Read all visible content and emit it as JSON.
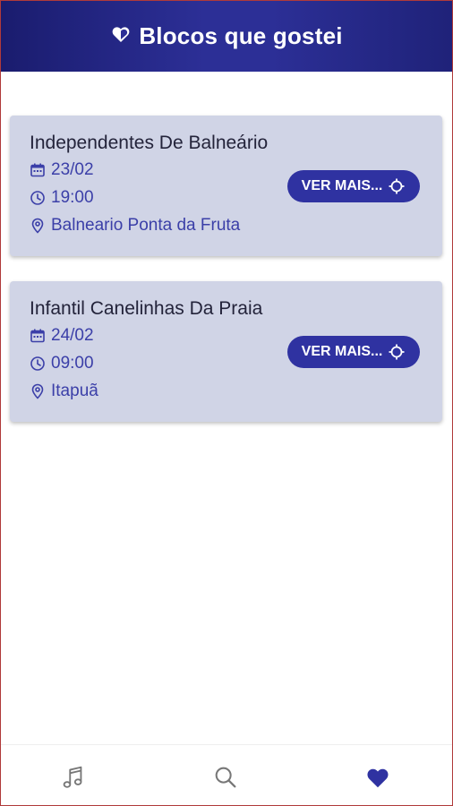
{
  "header": {
    "title": "Blocos que gostei",
    "icon": "heart-icon"
  },
  "cards": [
    {
      "name": "Independentes De Balneário",
      "date": "23/02",
      "time": "19:00",
      "place": "Balneario Ponta da Fruta",
      "button": "VER MAIS..."
    },
    {
      "name": "Infantil Canelinhas Da Praia",
      "date": "24/02",
      "time": "09:00",
      "place": "Itapuã",
      "button": "VER MAIS..."
    }
  ],
  "nav": [
    {
      "icon": "music-note-icon",
      "active": false
    },
    {
      "icon": "search-icon",
      "active": false
    },
    {
      "icon": "heart-icon",
      "active": true
    }
  ],
  "colors": {
    "header": "#2c2f96",
    "accent": "#2f32a1",
    "card_bg": "#d0d4e6",
    "info_text": "#3b3fa8",
    "active_nav": "#2f32a1",
    "inactive_nav": "#777777"
  }
}
